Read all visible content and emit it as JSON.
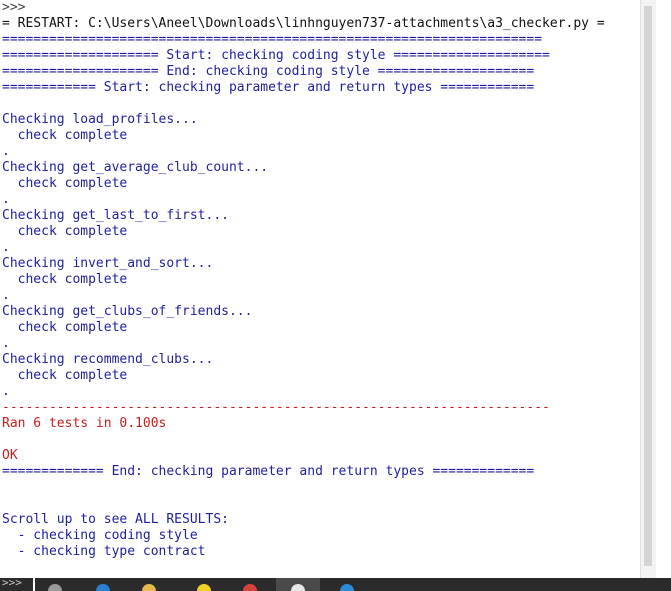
{
  "colors": {
    "prompt": "#444444",
    "restart": "#111111",
    "output": "#1f1fa0",
    "error": "#c81e1e",
    "background": "#ffffff",
    "taskbar": "#2b2b2b"
  },
  "console": {
    "lines": [
      {
        "text": ">>> ",
        "color": "#444444"
      },
      {
        "text": "= RESTART: C:\\Users\\Aneel\\Downloads\\linhnguyen737-attachments\\a3_checker.py =",
        "color": "#111111"
      },
      {
        "text": "=====================================================================",
        "color": "#1f1fa0"
      },
      {
        "text": "==================== Start: checking coding style ====================",
        "color": "#1f1fa0"
      },
      {
        "text": "==================== End: checking coding style ====================",
        "color": "#1f1fa0"
      },
      {
        "text": "============ Start: checking parameter and return types ============",
        "color": "#1f1fa0"
      },
      {
        "text": "",
        "color": "#1f1fa0"
      },
      {
        "text": "Checking load_profiles...",
        "color": "#1f1fa0"
      },
      {
        "text": "  check complete",
        "color": "#1f1fa0"
      },
      {
        "text": ".",
        "color": "#1f1fa0"
      },
      {
        "text": "Checking get_average_club_count...",
        "color": "#1f1fa0"
      },
      {
        "text": "  check complete",
        "color": "#1f1fa0"
      },
      {
        "text": ".",
        "color": "#1f1fa0"
      },
      {
        "text": "Checking get_last_to_first...",
        "color": "#1f1fa0"
      },
      {
        "text": "  check complete",
        "color": "#1f1fa0"
      },
      {
        "text": ".",
        "color": "#1f1fa0"
      },
      {
        "text": "Checking invert_and_sort...",
        "color": "#1f1fa0"
      },
      {
        "text": "  check complete",
        "color": "#1f1fa0"
      },
      {
        "text": ".",
        "color": "#1f1fa0"
      },
      {
        "text": "Checking get_clubs_of_friends...",
        "color": "#1f1fa0"
      },
      {
        "text": "  check complete",
        "color": "#1f1fa0"
      },
      {
        "text": ".",
        "color": "#1f1fa0"
      },
      {
        "text": "Checking recommend_clubs...",
        "color": "#1f1fa0"
      },
      {
        "text": "  check complete",
        "color": "#1f1fa0"
      },
      {
        "text": ".",
        "color": "#1f1fa0"
      },
      {
        "text": "----------------------------------------------------------------------",
        "color": "#c81e1e"
      },
      {
        "text": "Ran 6 tests in 0.100s",
        "color": "#c81e1e"
      },
      {
        "text": "",
        "color": "#c81e1e"
      },
      {
        "text": "OK",
        "color": "#c81e1e"
      },
      {
        "text": "============= End: checking parameter and return types =============",
        "color": "#1f1fa0"
      },
      {
        "text": "",
        "color": "#1f1fa0"
      },
      {
        "text": "",
        "color": "#1f1fa0"
      },
      {
        "text": "Scroll up to see ALL RESULTS:",
        "color": "#1f1fa0"
      },
      {
        "text": "  - checking coding style",
        "color": "#1f1fa0"
      },
      {
        "text": "  - checking type contract",
        "color": "#1f1fa0"
      }
    ]
  },
  "taskbar": {
    "prompt_text": ">>>",
    "icons": [
      "folder-icon",
      "browser-icon",
      "file-icon",
      "warning-icon",
      "chrome-icon",
      "python-idle-icon",
      "outlook-icon"
    ]
  }
}
